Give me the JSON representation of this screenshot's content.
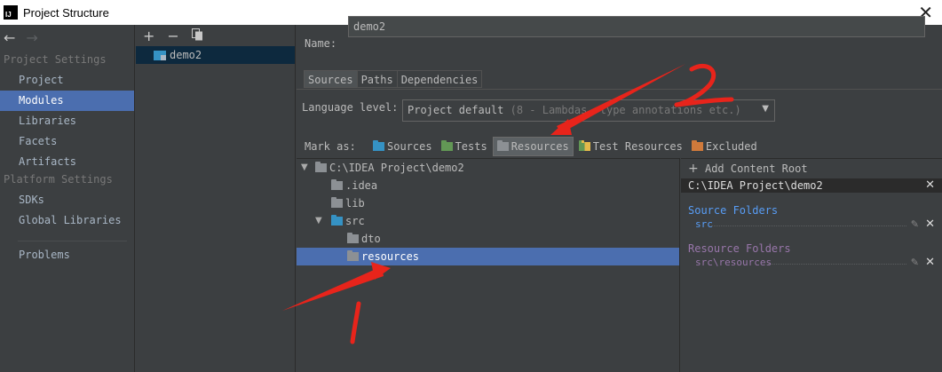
{
  "window": {
    "title": "Project Structure",
    "app_icon_text": "IJ",
    "close_icon": "close-icon"
  },
  "nav": {
    "back_icon": "←",
    "forward_icon": "→",
    "project_settings_header": "Project Settings",
    "project_settings": [
      "Project",
      "Modules",
      "Libraries",
      "Facets",
      "Artifacts"
    ],
    "platform_settings_header": "Platform Settings",
    "platform_settings": [
      "SDKs",
      "Global Libraries"
    ],
    "problems": "Problems",
    "selected": "Modules"
  },
  "module_list": {
    "add_icon": "+",
    "remove_icon": "−",
    "copy_icon": "copy-icon",
    "items": [
      "demo2"
    ]
  },
  "module": {
    "name_label": "Name:",
    "name_value": "demo2",
    "tabs": [
      "Sources",
      "Paths",
      "Dependencies"
    ],
    "active_tab": "Sources",
    "language_level_label": "Language level:",
    "language_level_value": "Project default",
    "language_level_detail": "(8 - Lambdas, type annotations etc.)",
    "mark_as_label": "Mark as:",
    "mark_as": [
      {
        "label": "Sources",
        "icon": "sources-folder-icon",
        "color": "#3592c4",
        "pressed": false
      },
      {
        "label": "Tests",
        "icon": "tests-folder-icon",
        "color": "#629755",
        "pressed": false
      },
      {
        "label": "Resources",
        "icon": "resources-folder-icon",
        "color": "#8c9094",
        "pressed": true
      },
      {
        "label": "Test Resources",
        "icon": "test-resources-folder-icon",
        "color": "#629755",
        "pressed": false
      },
      {
        "label": "Excluded",
        "icon": "excluded-folder-icon",
        "color": "#d07a3b",
        "pressed": false
      }
    ]
  },
  "tree": {
    "root": "C:\\IDEA Project\\demo2",
    "idea": ".idea",
    "lib": "lib",
    "src": "src",
    "dto": "dto",
    "resources": "resources",
    "selected": "resources"
  },
  "content_roots": {
    "add_label": "Add Content Root",
    "root_path": "C:\\IDEA Project\\demo2",
    "source_folders_header": "Source Folders",
    "source_folders": [
      "src"
    ],
    "resource_folders_header": "Resource Folders",
    "resource_folders": [
      "src\\resources"
    ]
  },
  "annotations": {
    "label_1": "1",
    "label_2": "2",
    "color": "#e8241b"
  }
}
